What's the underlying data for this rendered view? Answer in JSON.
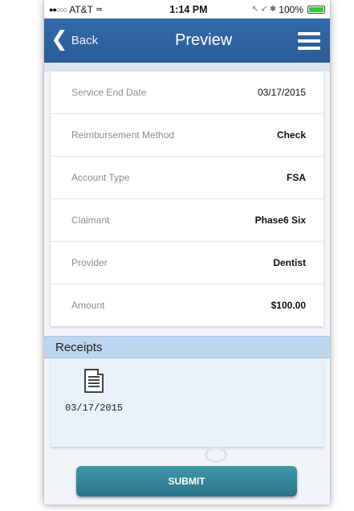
{
  "status_bar": {
    "carrier": "AT&T",
    "signal_dots": "●●○○○",
    "wifi_icon": "wifi-icon",
    "time": "1:14 PM",
    "icons": "↖ ➶ ✱",
    "battery": "100%"
  },
  "nav": {
    "back_label": "Back",
    "back_glyph": "❮",
    "title": "Preview"
  },
  "details": [
    {
      "label": "Service End Date",
      "value": "03/17/2015"
    },
    {
      "label": "Reimbursement Method",
      "value": "Check"
    },
    {
      "label": "Account Type",
      "value": "FSA"
    },
    {
      "label": "Claimant",
      "value": "Phase6 Six"
    },
    {
      "label": "Provider",
      "value": "Dentist"
    },
    {
      "label": "Amount",
      "value": "$100.00"
    }
  ],
  "receipts": {
    "header": "Receipts",
    "items": [
      {
        "date": "03/17/2015"
      }
    ]
  },
  "submit_label": "SUBMIT",
  "colors": {
    "nav_bg": "#2b5c96",
    "receipts_header_bg": "#bdd6ee",
    "submit_bg": "#2b7488"
  }
}
